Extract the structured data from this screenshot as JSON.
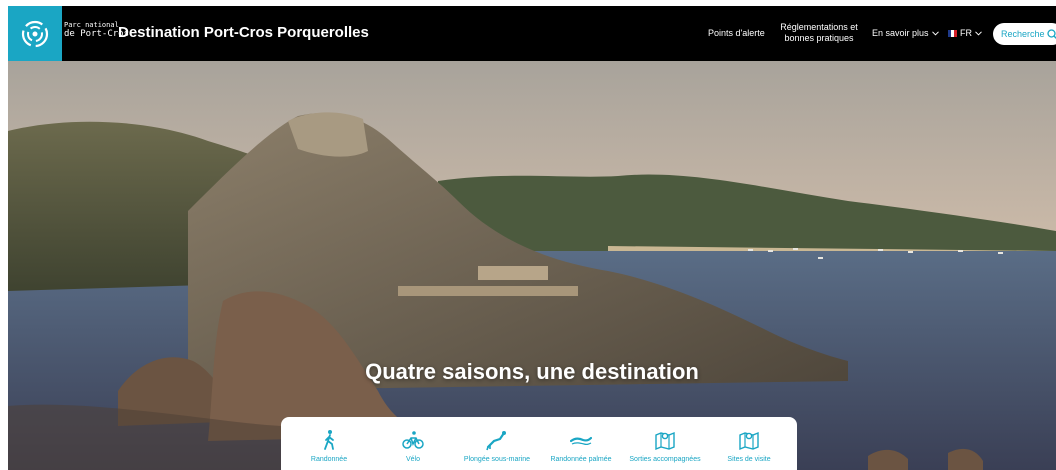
{
  "header": {
    "logo_line1": "Parc national",
    "logo_line2": "de Port-Cros",
    "site_title": "Destination Port-Cros Porquerolles"
  },
  "nav": {
    "points_alerte": "Points d'alerte",
    "reglementations": "Réglementations et bonnes pratiques",
    "en_savoir_plus": "En savoir plus",
    "lang": "FR",
    "search_label": "Recherche"
  },
  "hero": {
    "title": "Quatre saisons, une destination"
  },
  "activities": [
    {
      "label": "Randonnée",
      "icon": "hiker-icon"
    },
    {
      "label": "Vélo",
      "icon": "bicycle-icon"
    },
    {
      "label": "Plongée sous-marine",
      "icon": "diver-icon"
    },
    {
      "label": "Randonnée palmée",
      "icon": "snorkeler-icon"
    },
    {
      "label": "Sorties accompagnées",
      "icon": "map-pin-icon"
    },
    {
      "label": "Sites de visite",
      "icon": "map-pin-icon"
    }
  ],
  "colors": {
    "accent": "#1aa6c4",
    "header_bg": "#000000"
  }
}
